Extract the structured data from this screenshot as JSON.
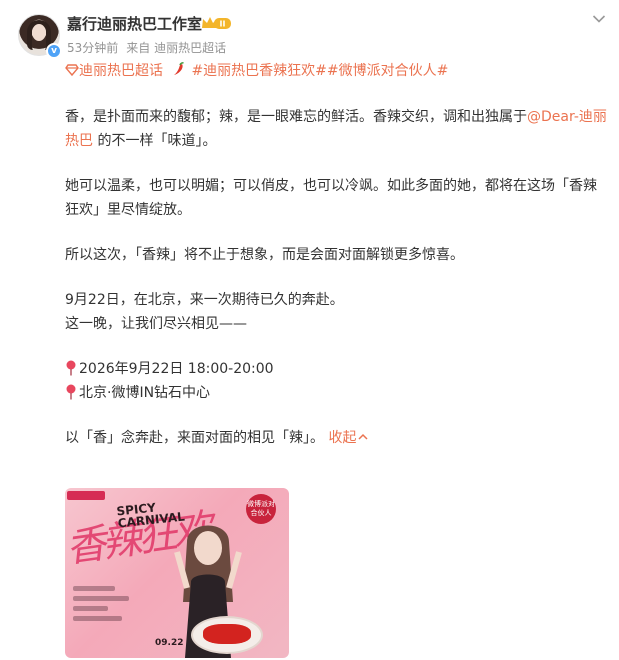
{
  "post": {
    "author": "嘉行迪丽热巴工作室",
    "time": "53分钟前",
    "source": "来自 迪丽热巴超话",
    "level_badge": "II",
    "verified_mark": "v"
  },
  "tags": {
    "super_topic": "迪丽热巴超话",
    "hashtags": "#迪丽热巴香辣狂欢##微博派对合伙人#"
  },
  "body": {
    "p1_before": "香，是扑面而来的馥郁；辣，是一眼难忘的鲜活。香辣交织，调和出独属于",
    "p1_mention_a": "@Dear-迪丽",
    "p1_mention_b": "热巴",
    "p1_after": " 的不一样「味道」。",
    "p2_l1": "她可以温柔，也可以明媚；可以俏皮，也可以冷飒。如此多面的她，都将在这场「香辣",
    "p2_l2": "狂欢」里尽情绽放。",
    "p3": "所以这次，「香辣」将不止于想象，而是会面对面解锁更多惊喜。",
    "p4_l1": "9月22日，在北京，来一次期待已久的奔赴。",
    "p4_l2": "这一晚，让我们尽兴相见——",
    "p5_date": "2026年9月22日 18:00-20:00",
    "p5_place": "北京·微博IN钻石中心",
    "p6_text": "以「香」念奔赴，来面对面的相见「辣」。",
    "collapse": "收起"
  },
  "poster": {
    "script_text": "香辣狂欢",
    "title_line1": "SPICY",
    "title_line2": "CARNIVAL",
    "logo_text": "微博派对合伙人",
    "date_tag": "09.22"
  },
  "colors": {
    "accent": "#eb7350",
    "text": "#333333",
    "meta": "#939393",
    "verify": "#4fa3f7",
    "pin": "#e8475e"
  },
  "icons": {
    "verified": "verified-badge-icon",
    "level": "crown-level-icon",
    "menu": "chevron-down-icon",
    "super_topic": "super-topic-diamond-icon",
    "chili": "chili-icon",
    "location": "pin-icon",
    "collapse": "chevron-up-icon"
  }
}
